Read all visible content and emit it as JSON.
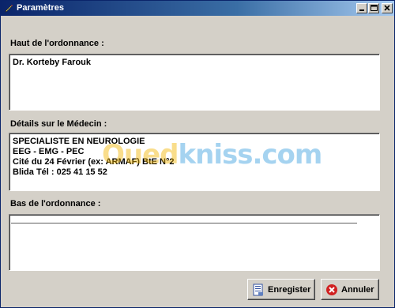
{
  "window": {
    "title": "Paramètres"
  },
  "sections": {
    "header": {
      "label": "Haut de l'ordonnance :",
      "lines": [
        "Dr. Korteby Farouk"
      ]
    },
    "doctor": {
      "label": "Détails sur le Médecin :",
      "lines": [
        "SPECIALISTE EN NEUROLOGIE",
        "EEG - EMG - PEC",
        "Cité du 24 Février (ex: ARMAF) BtE N°2",
        "Blida Tél : 025 41 15 52"
      ]
    },
    "footer": {
      "label": "Bas de l'ordonnance :"
    }
  },
  "watermark": {
    "part1": "Oued",
    "part2": "kniss.com"
  },
  "buttons": {
    "save": "Enregister",
    "cancel": "Annuler"
  },
  "icons": {
    "title": "pen-icon",
    "save": "save-icon",
    "cancel": "cancel-icon"
  },
  "colors": {
    "titlebar": "#0a246a",
    "face": "#d4d0c8",
    "cancel_icon": "#d02020"
  }
}
